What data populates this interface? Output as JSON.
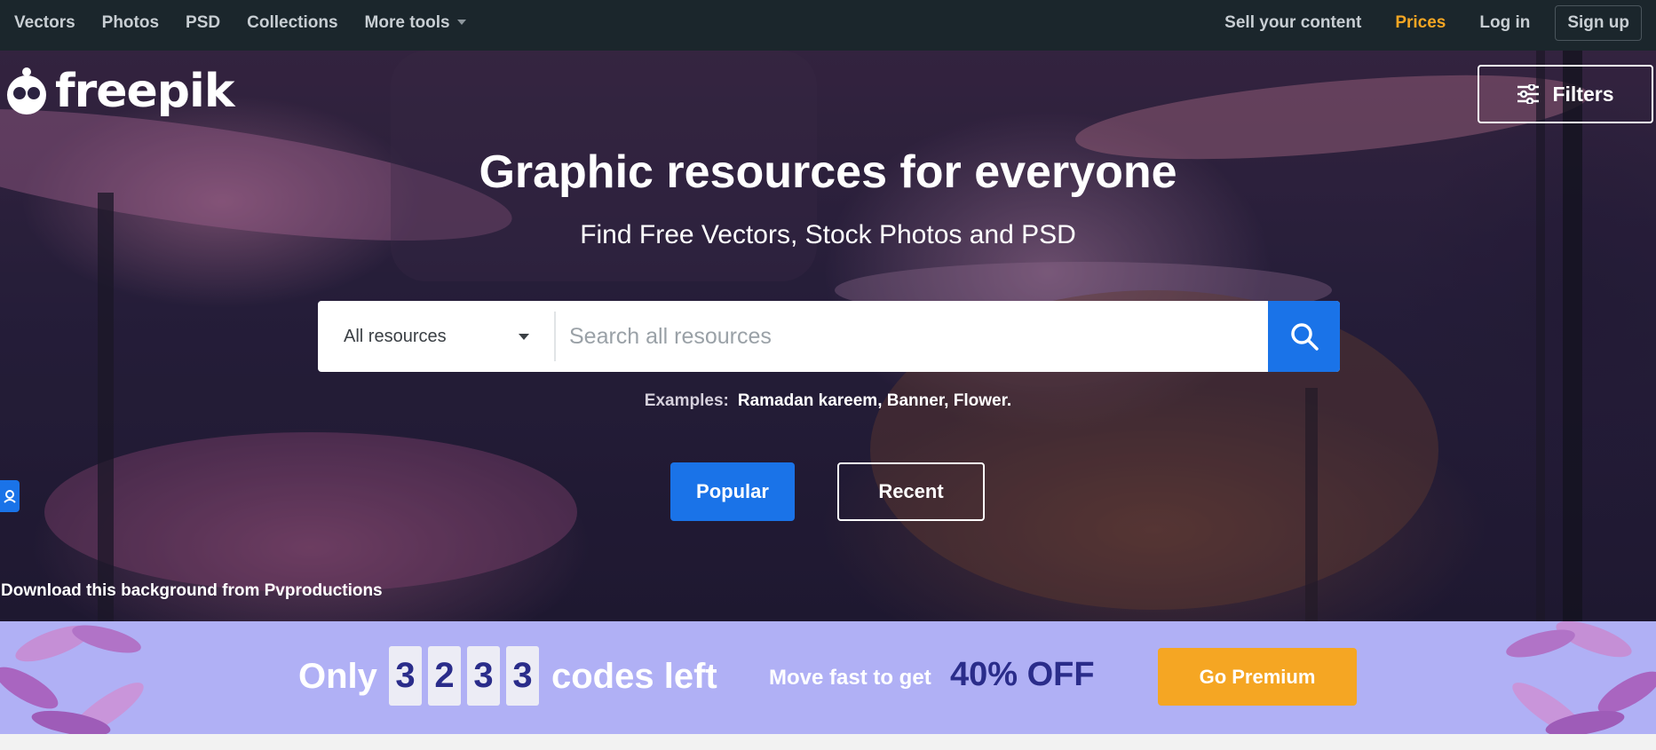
{
  "nav": {
    "left": [
      "Vectors",
      "Photos",
      "PSD",
      "Collections",
      "More tools"
    ],
    "sell": "Sell your content",
    "prices": "Prices",
    "login": "Log in",
    "signup": "Sign up"
  },
  "brand": {
    "logo_text": "freepik"
  },
  "filters": {
    "label": "Filters"
  },
  "hero": {
    "title": "Graphic resources for everyone",
    "subtitle": "Find Free Vectors, Stock Photos and PSD"
  },
  "search": {
    "resource_type": "All resources",
    "placeholder": "Search all resources",
    "examples_label": "Examples:",
    "examples": "Ramadan kareem, Banner, Flower."
  },
  "tabs": {
    "popular": "Popular",
    "recent": "Recent"
  },
  "credit": "Download this background from Pvproductions",
  "promo": {
    "only": "Only",
    "digits": [
      "3",
      "2",
      "3",
      "3"
    ],
    "codes_left": "codes left",
    "move": "Move fast to get",
    "off": "40% OFF",
    "cta": "Go Premium"
  },
  "colors": {
    "nav_bg": "#1b262c",
    "accent_blue": "#1a73e8",
    "prices_orange": "#f5a623",
    "promo_bg": "#b0b0f5",
    "promo_dark": "#2a2c8a"
  },
  "icons": [
    "chevron-down-icon",
    "filters-sliders-icon",
    "search-icon",
    "freepik-logo-icon",
    "support-icon",
    "flower-decoration"
  ]
}
